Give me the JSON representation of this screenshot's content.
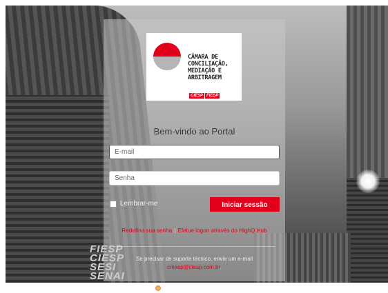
{
  "logo": {
    "lines": [
      "CÂMARA DE",
      "CONCILIAÇÃO,",
      "MEDIAÇÃO E",
      "ARBITRAGEM"
    ],
    "tag1": "CIESP",
    "tag2": "FIESP"
  },
  "welcome": "Bem-vindo ao Portal",
  "form": {
    "email_placeholder": "E-mail",
    "password_placeholder": "Senha",
    "remember_label": "Lembrar-me",
    "signin_label": "Iniciar sessão"
  },
  "links": {
    "reset": "Redefina sua senha",
    "separator": "|",
    "highq": "Efetue logon através do HighQ Hub"
  },
  "support": {
    "text": "Se precisar de suporte técnico, envie um e-mail",
    "email": "cmasp@ciesp.com.br",
    "suffix": "."
  },
  "background_text": [
    "FIESP",
    "CIESP",
    "SESI",
    "SENAI"
  ],
  "colors": {
    "accent": "#e3001b"
  }
}
